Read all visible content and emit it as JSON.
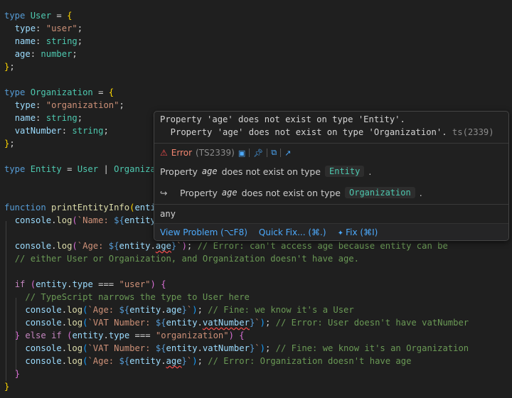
{
  "code": {
    "l1_kw": "type",
    "l1_name": "User",
    "l1_eq": " = ",
    "l2_prop": "type",
    "l2_val": "\"user\"",
    "l3_prop": "name",
    "l3_type": "string",
    "l4_prop": "age",
    "l4_type": "number",
    "l7_kw": "type",
    "l7_name": "Organization",
    "l7_eq": " = ",
    "l8_prop": "type",
    "l8_val": "\"organization\"",
    "l9_prop": "name",
    "l9_type": "string",
    "l10_prop": "vatNumber",
    "l10_type": "string",
    "l13_kw": "type",
    "l13_name": "Entity",
    "l13_eq": " = ",
    "l13_t1": "User",
    "l13_bar": " | ",
    "l13_t2": "Organiza",
    "l16_kw": "function",
    "l16_fn": "printEntityInfo",
    "l16_rest": "enti",
    "l17_obj": "console",
    "l17_fn": "log",
    "l17_str": "`Name: ",
    "l17_interp": "${",
    "l17_var": "entity",
    "l19_obj": "console",
    "l19_fn": "log",
    "l19_str": "`Age: ",
    "l19_var": "entity",
    "l19_prop": "age",
    "l19_com": "// Error: can't access age because entity can be",
    "l20_com": "// either User or Organization, and Organization doesn't have age.",
    "l22_kw": "if",
    "l22_var": "entity",
    "l22_prop": "type",
    "l22_op": " === ",
    "l22_str": "\"user\"",
    "l23_com": "// TypeScript narrows the type to User here",
    "l24_obj": "console",
    "l24_fn": "log",
    "l24_str": "`Age: ",
    "l24_var": "entity",
    "l24_prop": "age",
    "l24_com": "// Fine: we know it's a User",
    "l25_obj": "console",
    "l25_fn": "log",
    "l25_str": "`VAT Number: ",
    "l25_var": "entity",
    "l25_prop": "vatNumber",
    "l25_com": "// Error: User doesn't have vatNumber",
    "l26_kw1": "else",
    "l26_kw2": "if",
    "l26_var": "entity",
    "l26_prop": "type",
    "l26_op": " === ",
    "l26_str": "\"organization\"",
    "l27_obj": "console",
    "l27_fn": "log",
    "l27_str": "`VAT Number: ",
    "l27_var": "entity",
    "l27_prop": "vatNumber",
    "l27_com": "// Fine: we know it's an Organization",
    "l28_obj": "console",
    "l28_fn": "log",
    "l28_str": "`Age: ",
    "l28_var": "entity",
    "l28_prop": "age",
    "l28_com": "// Error: Organization doesn't have age"
  },
  "hover": {
    "line1": "Property 'age' does not exist on type 'Entity'.",
    "line2": "  Property 'age' does not exist on type 'Organization'.",
    "line2_code": "ts(2339)",
    "error_label": "Error",
    "error_code": "(TS2339)",
    "msg1_pre": "Property",
    "msg1_ital": "age",
    "msg1_mid": "does not exist on type",
    "msg1_type": "Entity",
    "msg1_end": ".",
    "msg2_pre": "Property",
    "msg2_ital": "age",
    "msg2_mid": "does not exist on type",
    "msg2_type": "Organization",
    "msg2_end": ".",
    "arrow_glyph": "↪",
    "type_any": "any",
    "actions": {
      "view_problem": "View Problem (⌥F8)",
      "quick_fix": "Quick Fix... (⌘.)",
      "fix": "Fix (⌘I)"
    }
  },
  "colors": {
    "background": "#1f1f1f",
    "keyword": "#569cd6",
    "type": "#4ec9b0",
    "string": "#ce9178",
    "comment": "#6a9955",
    "error": "#f14c4c",
    "link": "#4daafc"
  }
}
